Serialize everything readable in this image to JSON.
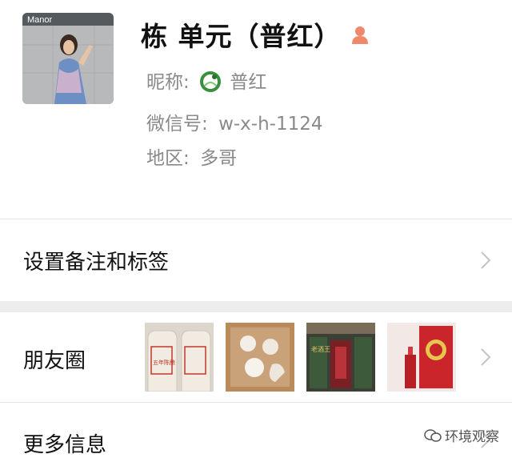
{
  "profile": {
    "name": "栋 单元（普红）",
    "nickname_label": "昵称:",
    "nickname": "普红",
    "wechat_id_label": "微信号:",
    "wechat_id": "w-x-h-1124",
    "region_label": "地区:",
    "region": "多哥",
    "avatar_sign_text": "Manor"
  },
  "rows": {
    "remark_label": "设置备注和标签",
    "moments_label": "朋友圈",
    "more_info_label": "更多信息"
  },
  "moments": {
    "thumbs": [
      {
        "name": "baijiu-bottles-thumb",
        "label": "五年陈酿"
      },
      {
        "name": "white-jars-box-thumb",
        "label": ""
      },
      {
        "name": "laojiuwang-boxes-thumb",
        "label": "老酒王"
      },
      {
        "name": "red-gift-box-thumb",
        "label": ""
      }
    ]
  },
  "watermark": {
    "text": "环境观察"
  },
  "icons": {
    "gender": "female-person-icon",
    "chevron": "chevron-right-icon"
  },
  "colors": {
    "gender_icon": "#f0896c",
    "secondary_text": "#8a8a8a",
    "separator": "#ededed"
  }
}
